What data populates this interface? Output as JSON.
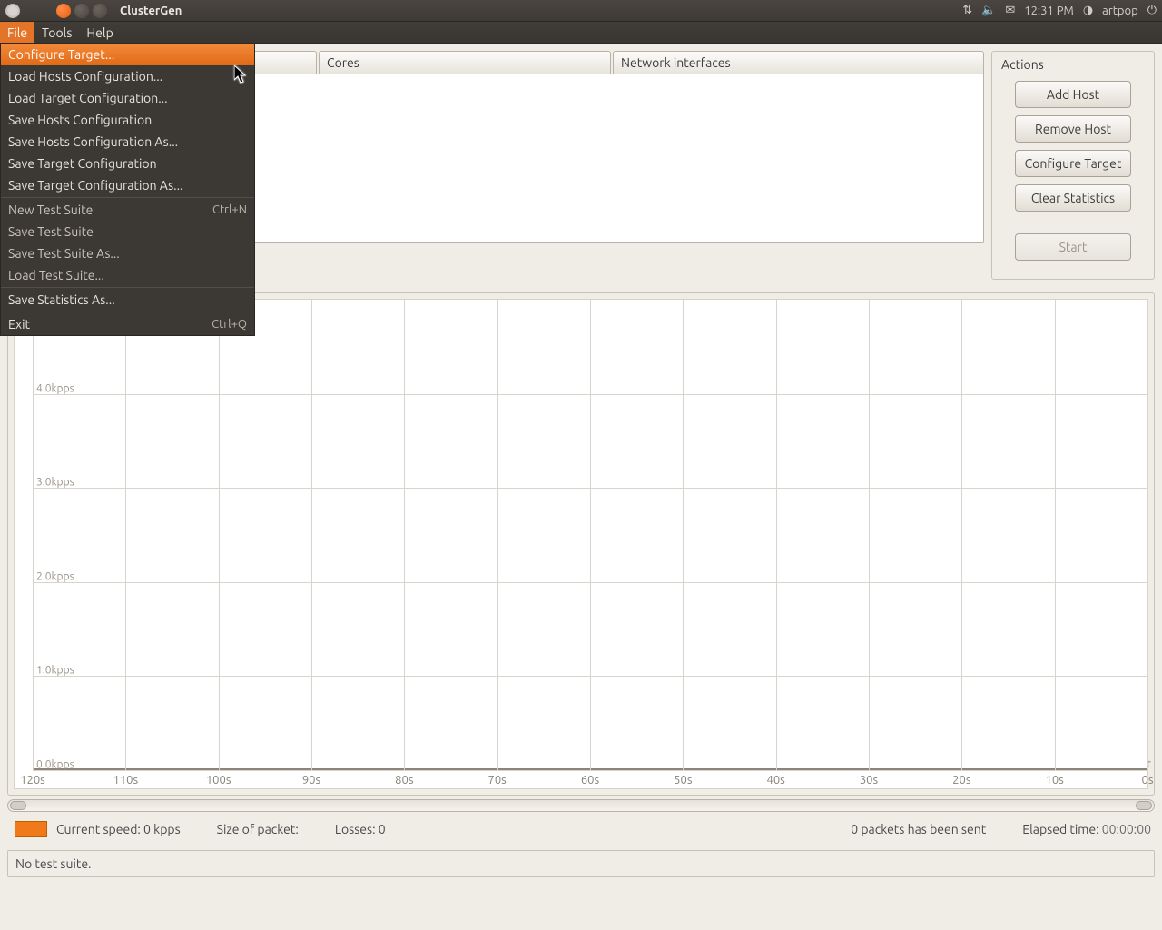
{
  "top_panel": {
    "app_title": "ClusterGen",
    "time": "12:31 PM",
    "user": "artpop"
  },
  "menu_bar": {
    "file": "File",
    "tools": "Tools",
    "help": "Help"
  },
  "file_menu": {
    "items": [
      {
        "label": "Configure Target...",
        "shortcut": ""
      },
      {
        "label": "Load Hosts Configuration...",
        "shortcut": ""
      },
      {
        "label": "Load Target Configuration...",
        "shortcut": ""
      },
      {
        "label": "Save Hosts Configuration",
        "shortcut": ""
      },
      {
        "label": "Save Hosts Configuration As...",
        "shortcut": ""
      },
      {
        "label": "Save Target Configuration",
        "shortcut": ""
      },
      {
        "label": "Save Target Configuration As...",
        "shortcut": ""
      },
      {
        "label": "New Test Suite",
        "shortcut": "Ctrl+N"
      },
      {
        "label": "Save Test Suite",
        "shortcut": ""
      },
      {
        "label": "Save Test Suite As...",
        "shortcut": ""
      },
      {
        "label": "Load Test Suite...",
        "shortcut": ""
      },
      {
        "label": "Save Statistics As...",
        "shortcut": ""
      },
      {
        "label": "Exit",
        "shortcut": "Ctrl+Q"
      }
    ]
  },
  "columns": {
    "hostname": "",
    "cores": "Cores",
    "net": "Network interfaces"
  },
  "actions": {
    "title": "Actions",
    "add_host": "Add Host",
    "remove_host": "Remove Host",
    "configure_target": "Configure Target",
    "clear_stats": "Clear Statistics",
    "start": "Start"
  },
  "chart_data": {
    "type": "line",
    "series": [
      {
        "name": "Current speed",
        "values": []
      }
    ],
    "x_ticks": [
      "120s",
      "110s",
      "100s",
      "90s",
      "80s",
      "70s",
      "60s",
      "50s",
      "40s",
      "30s",
      "20s",
      "10s",
      "0s"
    ],
    "y_ticks": [
      "0.0kpps",
      "1.0kpps",
      "2.0kpps",
      "3.0kpps",
      "4.0kpps"
    ],
    "xlabel": "t",
    "ylabel": "",
    "ylim": [
      0,
      5
    ],
    "xlim": [
      120,
      0
    ]
  },
  "stats": {
    "current_speed_label": "Current speed: 0 kpps",
    "size_label": "Size of packet:",
    "losses_label": "Losses: 0",
    "sent_label": "0 packets has been sent",
    "elapsed_label": "Elapsed time:",
    "elapsed_value": "00:00:00"
  },
  "footer": {
    "status": "No test suite."
  }
}
